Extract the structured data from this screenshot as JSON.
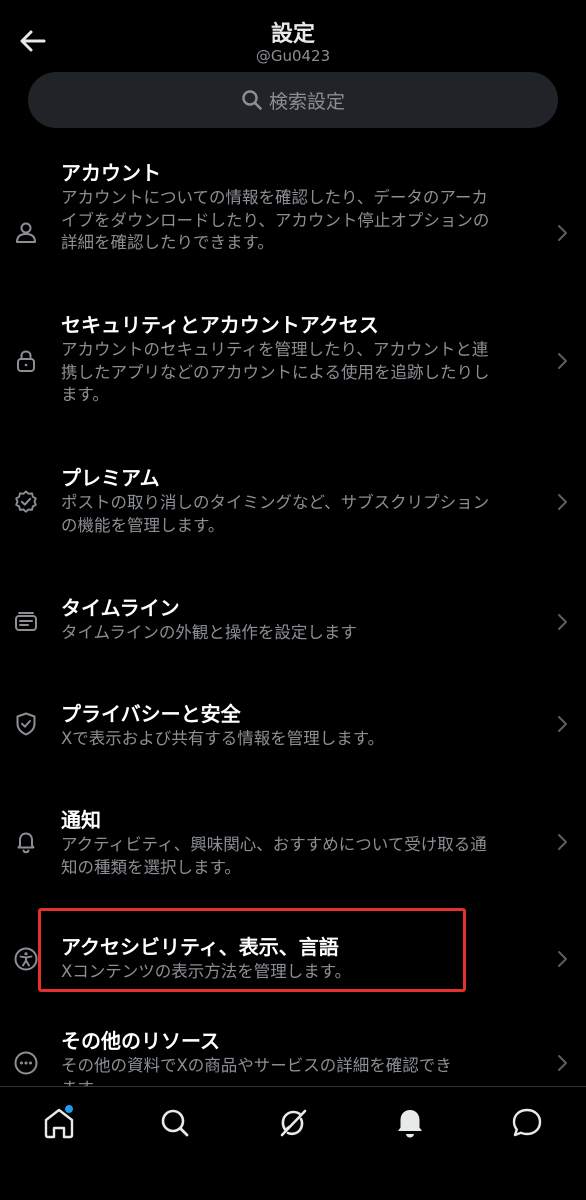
{
  "header": {
    "title": "設定",
    "handle": "@Gu0423"
  },
  "search": {
    "placeholder": "検索設定"
  },
  "settings": [
    {
      "title": "アカウント",
      "desc_lines": [
        "アカウントについての情報を確認したり、データのアーカ",
        "イブをダウンロードしたり、アカウント停止オプションの",
        "詳細を確認したりできます。"
      ],
      "icon": "person-icon"
    },
    {
      "title": "セキュリティとアカウントアクセス",
      "desc_lines": [
        "アカウントのセキュリティを管理したり、アカウントと連",
        "携したアプリなどのアカウントによる使用を追跡したりし",
        "ます。"
      ],
      "icon": "lock-icon"
    },
    {
      "title": "プレミアム",
      "desc_lines": [
        "ポストの取り消しのタイミングなど、サブスクリプション",
        "の機能を管理します。"
      ],
      "icon": "verified-badge-icon"
    },
    {
      "title": "タイムライン",
      "desc_lines": [
        "タイムラインの外観と操作を設定します"
      ],
      "icon": "timeline-icon"
    },
    {
      "title": "プライバシーと安全",
      "desc_lines": [
        "Xで表示および共有する情報を管理します。"
      ],
      "icon": "shield-icon"
    },
    {
      "title": "通知",
      "desc_lines": [
        "アクティビティ、興味関心、おすすめについて受け取る通",
        "知の種類を選択します。"
      ],
      "icon": "bell-icon"
    },
    {
      "title": "アクセシビリティ、表示、言語",
      "desc_lines": [
        "Xコンテンツの表示方法を管理します。"
      ],
      "icon": "accessibility-icon"
    },
    {
      "title": "その他のリソース",
      "desc_lines": [
        "その他の資料でXの商品やサービスの詳細を確認でき",
        "ます。"
      ],
      "icon": "more-circle-icon"
    }
  ],
  "highlight_color": "#e5312b",
  "accent_color": "#1d9bf0",
  "nav": [
    {
      "icon": "home-icon",
      "has_dot": true
    },
    {
      "icon": "search-icon"
    },
    {
      "icon": "grok-icon"
    },
    {
      "icon": "bell-icon"
    },
    {
      "icon": "chat-icon"
    }
  ]
}
